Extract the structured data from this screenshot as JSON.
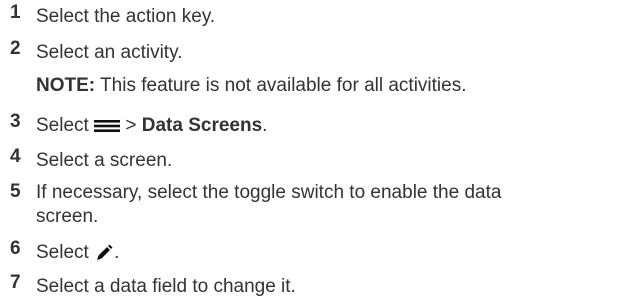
{
  "steps": [
    {
      "number": "1",
      "text": "Select the action key."
    },
    {
      "number": "2",
      "text": "Select an activity.",
      "note": {
        "label": "NOTE:",
        "text": " This feature is not available for all activities."
      }
    },
    {
      "number": "3",
      "prefix": "Select ",
      "icon": "menu-icon",
      "separator": " > ",
      "bold": "Data Screens",
      "suffix": "."
    },
    {
      "number": "4",
      "text": "Select a screen."
    },
    {
      "number": "5",
      "text": "If necessary, select the toggle switch to enable the data",
      "text2": "screen."
    },
    {
      "number": "6",
      "prefix": "Select ",
      "icon": "pencil-icon",
      "suffix": "."
    },
    {
      "number": "7",
      "text": "Select a data field to change it."
    }
  ]
}
